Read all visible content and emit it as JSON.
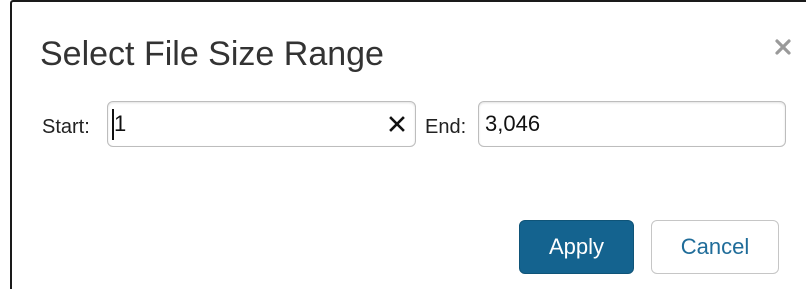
{
  "dialog": {
    "title": "Select File Size Range",
    "close_icon": "close-icon"
  },
  "start": {
    "label": "Start:",
    "value": "1",
    "clear_icon": "clear-icon"
  },
  "end": {
    "label": "End:",
    "value": "3,046"
  },
  "buttons": {
    "apply_label": "Apply",
    "cancel_label": "Cancel"
  },
  "colors": {
    "apply_bg": "#14638f",
    "cancel_text": "#1f6c99",
    "title_text": "#333333"
  }
}
